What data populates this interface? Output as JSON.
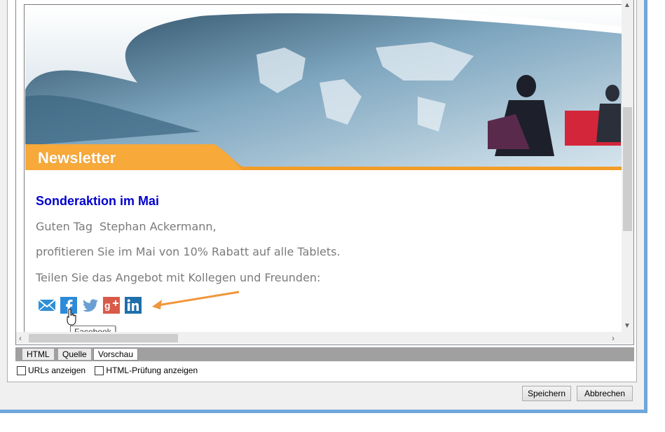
{
  "newsletter": {
    "banner_title": "Newsletter",
    "headline": "Sonderaktion im Mai",
    "greeting_prefix": "Guten Tag",
    "greeting_name": "Stephan Ackermann,",
    "offer_text": "profitieren Sie im Mai von 10% Rabatt auf alle Tablets.",
    "share_text": "Teilen Sie das Angebot mit Kollegen und Freunden:",
    "social_icons": [
      "email-icon",
      "facebook-icon",
      "twitter-icon",
      "google-plus-icon",
      "linkedin-icon"
    ],
    "tooltip": "Facebook"
  },
  "tabs": [
    {
      "label": "HTML"
    },
    {
      "label": "Quelle"
    },
    {
      "label": "Vorschau"
    }
  ],
  "active_tab": "Vorschau",
  "options": {
    "show_urls_label": "URLs anzeigen",
    "html_check_label": "HTML-Prüfung anzeigen"
  },
  "buttons": {
    "save_label": "Speichern",
    "cancel_label": "Abbrechen"
  },
  "colors": {
    "headline": "#0000cc",
    "body_text": "#7b7b7b",
    "banner_orange": "#f39c28",
    "annotation_arrow": "#f0963c",
    "window_border": "#6ea7da"
  }
}
